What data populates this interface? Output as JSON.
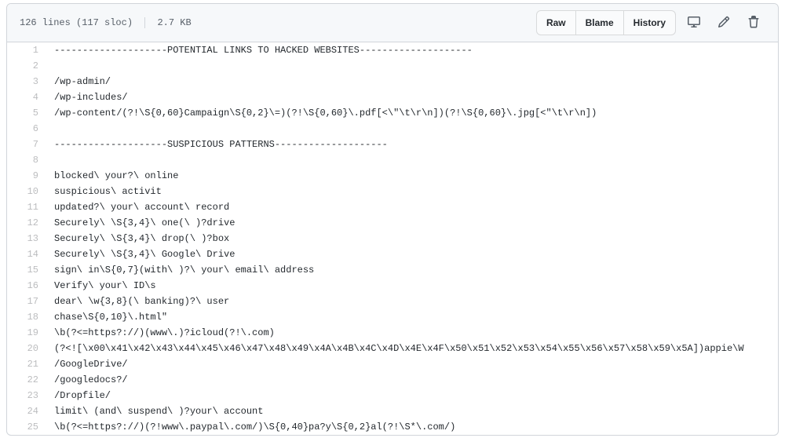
{
  "header": {
    "lines_text": "126 lines (117 sloc)",
    "size_text": "2.7 KB",
    "raw_label": "Raw",
    "blame_label": "Blame",
    "history_label": "History"
  },
  "code_lines": [
    {
      "n": 1,
      "c": "--------------------POTENTIAL LINKS TO HACKED WEBSITES--------------------"
    },
    {
      "n": 2,
      "c": ""
    },
    {
      "n": 3,
      "c": "/wp-admin/"
    },
    {
      "n": 4,
      "c": "/wp-includes/"
    },
    {
      "n": 5,
      "c": "/wp-content/(?!\\S{0,60}Campaign\\S{0,2}\\=)(?!\\S{0,60}\\.pdf[<\\\"\\t\\r\\n])(?!\\S{0,60}\\.jpg[<\"\\t\\r\\n])"
    },
    {
      "n": 6,
      "c": ""
    },
    {
      "n": 7,
      "c": "--------------------SUSPICIOUS PATTERNS--------------------"
    },
    {
      "n": 8,
      "c": ""
    },
    {
      "n": 9,
      "c": "blocked\\ your?\\ online"
    },
    {
      "n": 10,
      "c": "suspicious\\ activit"
    },
    {
      "n": 11,
      "c": "updated?\\ your\\ account\\ record"
    },
    {
      "n": 12,
      "c": "Securely\\ \\S{3,4}\\ one(\\ )?drive"
    },
    {
      "n": 13,
      "c": "Securely\\ \\S{3,4}\\ drop(\\ )?box"
    },
    {
      "n": 14,
      "c": "Securely\\ \\S{3,4}\\ Google\\ Drive"
    },
    {
      "n": 15,
      "c": "sign\\ in\\S{0,7}(with\\ )?\\ your\\ email\\ address"
    },
    {
      "n": 16,
      "c": "Verify\\ your\\ ID\\s"
    },
    {
      "n": 17,
      "c": "dear\\ \\w{3,8}(\\ banking)?\\ user"
    },
    {
      "n": 18,
      "c": "chase\\S{0,10}\\.html\""
    },
    {
      "n": 19,
      "c": "\\b(?<=https?://)(www\\.)?icloud(?!\\.com)"
    },
    {
      "n": 20,
      "c": "(?<![\\x00\\x41\\x42\\x43\\x44\\x45\\x46\\x47\\x48\\x49\\x4A\\x4B\\x4C\\x4D\\x4E\\x4F\\x50\\x51\\x52\\x53\\x54\\x55\\x56\\x57\\x58\\x59\\x5A])appie\\W"
    },
    {
      "n": 21,
      "c": "/GoogleDrive/"
    },
    {
      "n": 22,
      "c": "/googledocs?/"
    },
    {
      "n": 23,
      "c": "/Dropfile/"
    },
    {
      "n": 24,
      "c": "limit\\ (and\\ suspend\\ )?your\\ account"
    },
    {
      "n": 25,
      "c": "\\b(?<=https?://)(?!www\\.paypal\\.com/)\\S{0,40}pa?y\\S{0,2}al(?!\\S*\\.com/)"
    }
  ]
}
